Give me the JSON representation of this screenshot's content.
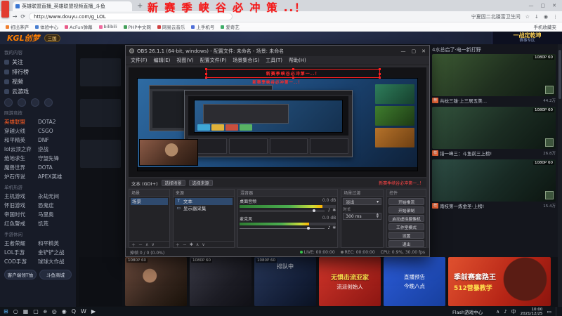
{
  "overlay": {
    "stream_title": "新 赛 季 峡 谷 必 冲 策 ..！"
  },
  "browser": {
    "tab_title": "英雄联盟直播_英雄联盟视频直播_斗鱼",
    "new_tab_label": "+",
    "back": "←",
    "forward": "→",
    "refresh": "⟳",
    "url": "http://www.douyu.com/g_LOL",
    "ext_text": "宁夏固二北疆富卫生间",
    "star": "☆",
    "download": "↓",
    "profile": "◉",
    "menu": "⋮",
    "min": "—",
    "max": "▢",
    "close": "✕",
    "bookmarks": [
      "初出茅庐",
      "体验中心",
      "AcFun弹幕",
      "bilibili",
      "PHP中文网",
      "网易云音乐",
      "上手机号",
      "爱奇艺"
    ],
    "bookmarks_right": "手机收藏夹"
  },
  "site": {
    "logo": "KGL创梦",
    "mascot": "三国",
    "banner_title": "一战定乾坤",
    "banner_sub": "赛事专区"
  },
  "sidebar": {
    "sections": {
      "my": "我的内容",
      "games": "网游竞技",
      "pc": "单机热游",
      "mobile": "手游休闲"
    },
    "my_items": [
      "关注",
      "排行榜",
      "视频",
      "云游戏"
    ],
    "games": [
      "英雄联盟",
      "DOTA2",
      "穿越火线",
      "CSGO",
      "和平精英",
      "DNF",
      "lol云顶之弈",
      "逆战",
      "绝地求生",
      "守望先锋",
      "魔兽世界",
      "DOTA",
      "炉石传说",
      "APEX英雄"
    ],
    "pc_games": [
      "主机游戏",
      "永劫无间",
      "怀旧游戏",
      "恐鬼症",
      "帝国时代",
      "马里奥",
      "红色警戒",
      "饥荒"
    ],
    "mobile_games": [
      "王者荣耀",
      "和平精英",
      "LOL手游",
      "金铲铲之战",
      "COD手游",
      "球球大作战"
    ],
    "buttons": [
      "客户端领T恤",
      "斗鱼商城"
    ]
  },
  "obs": {
    "title": "OBS 26.1.1 (64-bit, windows) - 配置文件: 未命名 - 场景: 未命名",
    "min": "—",
    "max": "▢",
    "close": "✕",
    "menus": [
      "文件(F)",
      "编辑(E)",
      "视图(V)",
      "配置文件(P)",
      "场景集合(S)",
      "工具(T)",
      "帮助(H)"
    ],
    "preview_text": "新赛季峡谷必冲第一..！",
    "quickbar": {
      "source": "文本 (GDI+)",
      "btn1": "选择场景",
      "btn2": "选择来源",
      "note": "新赛季峡谷必冲第一..！"
    },
    "docks": {
      "scenes": {
        "title": "场景",
        "items": [
          "场景"
        ],
        "toolbar": [
          "＋",
          "－",
          "∧",
          "∨"
        ]
      },
      "sources": {
        "title": "来源",
        "items": [
          {
            "icon": "T",
            "label": "文本"
          },
          {
            "icon": "▭",
            "label": "显示器采集"
          }
        ],
        "toolbar": [
          "＋",
          "－",
          "✱",
          "∧",
          "∨"
        ]
      },
      "mixer": {
        "title": "混音器",
        "speaker_icon": "♪",
        "gear_icon": "✱",
        "channels": [
          {
            "name": "桌面音频",
            "db": "0.0 dB"
          },
          {
            "name": "麦克风",
            "db": "0.0 dB"
          }
        ]
      },
      "transitions": {
        "title": "场景过渡",
        "value": "淡出",
        "caret": "▾",
        "duration_label": "时长",
        "duration": "300 ms"
      },
      "controls": {
        "title": "控件",
        "buttons": [
          "开始推流",
          "开始录制",
          "启动虚拟摄像机",
          "工作室模式",
          "设置",
          "退出"
        ]
      }
    },
    "status": {
      "dropped": "掉帧 0 / 0 (0.0%)",
      "live": "LIVE: 00:00:00",
      "rec": "REC: 00:00:00",
      "cpu": "CPU: 0.9%, 30.00 fps"
    }
  },
  "right_panel": {
    "partial_caption": "4水总启了·电一新打野",
    "cards": [
      {
        "badge": "1080P 60",
        "tag": "荐",
        "caption": "共枕三雄·上三居五美…",
        "viewers": "44.2万"
      },
      {
        "badge": "1080P 60",
        "tag": "荐",
        "caption": "错一峰三：斗鱼前三上榜!",
        "viewers": "26.8万"
      },
      {
        "badge": "1080P 60",
        "tag": "荐",
        "caption": "南枝第一炼金圣·上榜!",
        "viewers": "15.4万"
      }
    ]
  },
  "bottom_row": {
    "thumbs": [
      {
        "badge": "1080P 60"
      },
      {
        "badge": "1080P 60"
      },
      {
        "badge": "1080P 60",
        "overlay": "排队中"
      },
      {
        "line1": "无惧击流亚家",
        "line2": "流派创始人"
      },
      {
        "line1": "直播预告",
        "line2": "今晚八点"
      },
      {
        "line1": "季前赛套路王",
        "line2": "512营暴教学"
      }
    ]
  },
  "taskbar": {
    "icons": [
      {
        "name": "start",
        "glyph": "⊞"
      },
      {
        "name": "search",
        "glyph": "○"
      },
      {
        "name": "task-view",
        "glyph": "▦"
      },
      {
        "name": "file-explorer",
        "glyph": "▢"
      },
      {
        "name": "edge-browser",
        "glyph": "e"
      },
      {
        "name": "chrome-browser",
        "glyph": "◎"
      },
      {
        "name": "obs-app",
        "glyph": "◉"
      },
      {
        "name": "qq",
        "glyph": "Q"
      },
      {
        "name": "wechat",
        "glyph": "W"
      },
      {
        "name": "media-player",
        "glyph": "▶"
      }
    ],
    "flash_label": "Flash游戏中心",
    "tray_expand": "∧",
    "volume": "♪",
    "ime": "中",
    "notif": "▭",
    "time": "10:00",
    "date": "2021/12/25"
  }
}
